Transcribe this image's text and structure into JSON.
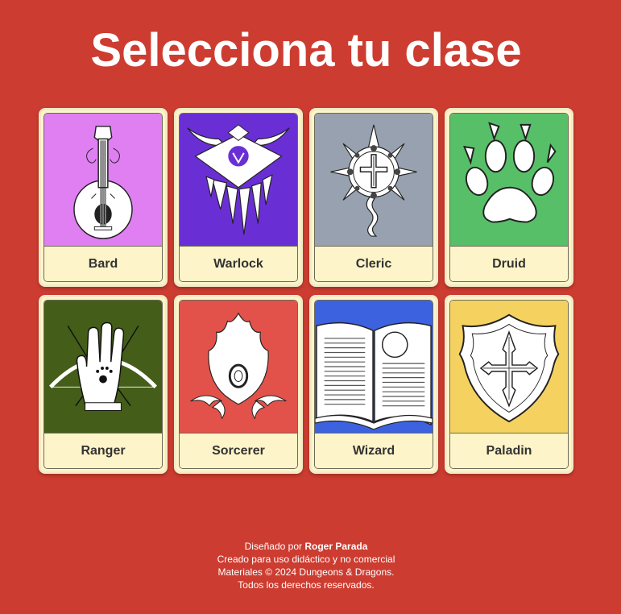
{
  "page": {
    "title": "Selecciona tu clase",
    "background_color": "#cd3c30"
  },
  "classes": [
    {
      "label": "Bard",
      "icon": "lute-icon",
      "color": "#df7ff2"
    },
    {
      "label": "Warlock",
      "icon": "warlock-sigil-icon",
      "color": "#6a2fd4"
    },
    {
      "label": "Cleric",
      "icon": "holy-symbol-icon",
      "color": "#97a1af"
    },
    {
      "label": "Druid",
      "icon": "paw-print-icon",
      "color": "#58bf69"
    },
    {
      "label": "Ranger",
      "icon": "hand-bow-arrows-icon",
      "color": "#445d18"
    },
    {
      "label": "Sorcerer",
      "icon": "flame-orb-icon",
      "color": "#e2524a"
    },
    {
      "label": "Wizard",
      "icon": "open-spellbook-icon",
      "color": "#3c62e0"
    },
    {
      "label": "Paladin",
      "icon": "shield-cross-icon",
      "color": "#f5d260"
    }
  ],
  "footer": {
    "designed_prefix": "Diseñado por",
    "designer": "Roger Parada",
    "line2": "Creado para uso didáctico y no comercial",
    "line3": "Materiales © 2024 Dungeons & Dragons.",
    "line4": "Todos los derechos reservados."
  }
}
